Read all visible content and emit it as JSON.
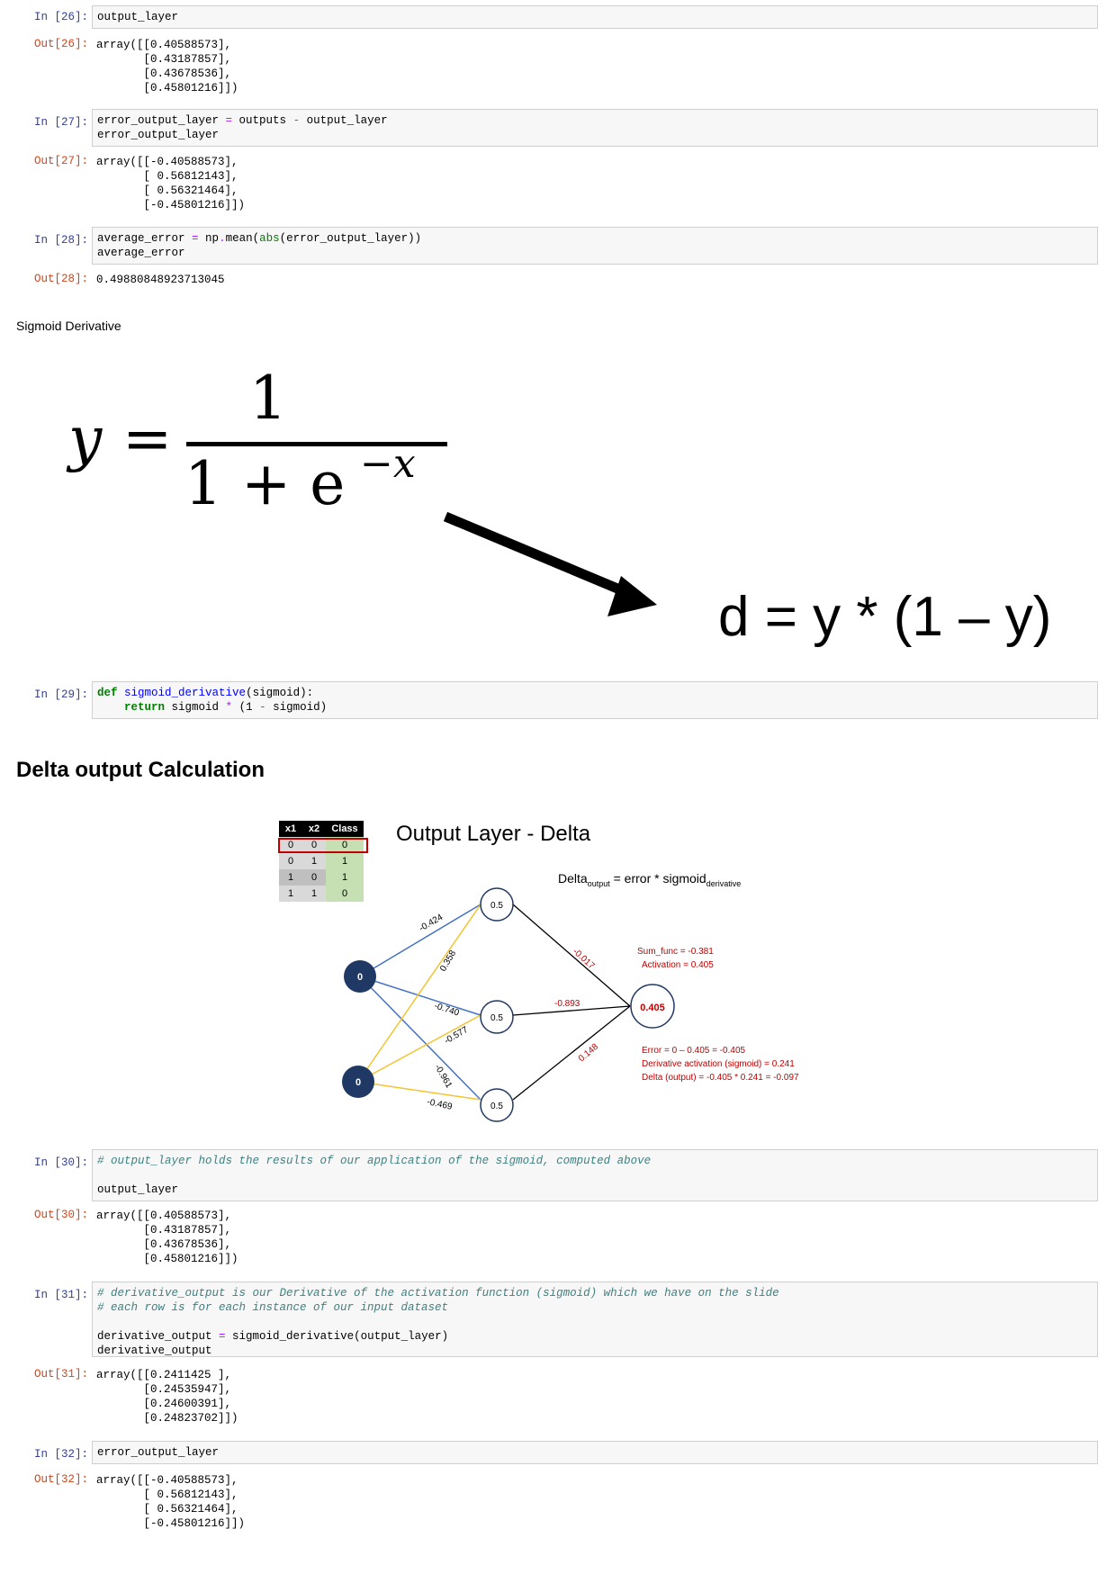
{
  "cells": [
    {
      "id": "26",
      "prompt_in": "In [26]:",
      "input": "output_layer",
      "prompt_out": "Out[26]:",
      "output": "array([[0.40588573],\n       [0.43187857],\n       [0.43678536],\n       [0.45801216]])"
    },
    {
      "id": "27",
      "prompt_in": "In [27]:",
      "input": "error_output_layer = outputs - output_layer\nerror_output_layer",
      "prompt_out": "Out[27]:",
      "output": "array([[-0.40588573],\n       [ 0.56812143],\n       [ 0.56321464],\n       [-0.45801216]])"
    },
    {
      "id": "28",
      "prompt_in": "In [28]:",
      "input": "average_error = np.mean(abs(error_output_layer))\naverage_error",
      "prompt_out": "Out[28]:",
      "output": "0.49880848923713045"
    },
    {
      "id": "29",
      "prompt_in": "In [29]:",
      "input": "def sigmoid_derivative(sigmoid):\n    return sigmoid * (1 - sigmoid)"
    },
    {
      "id": "30",
      "prompt_in": "In [30]:",
      "input": "# output_layer holds the results of our application of the sigmoid, computed above\n\noutput_layer",
      "prompt_out": "Out[30]:",
      "output": "array([[0.40588573],\n       [0.43187857],\n       [0.43678536],\n       [0.45801216]])"
    },
    {
      "id": "31",
      "prompt_in": "In [31]:",
      "input": "# derivative_output is our Derivative of the activation function (sigmoid) which we have on the slide\n# each row is for each instance of our input dataset\n\nderivative_output = sigmoid_derivative(output_layer)\nderivative_output",
      "prompt_out": "Out[31]:",
      "output": "array([[0.2411425 ],\n       [0.24535947],\n       [0.24600391],\n       [0.24823702]])"
    },
    {
      "id": "32",
      "prompt_in": "In [32]:",
      "input": "error_output_layer",
      "prompt_out": "Out[32]:",
      "output": "array([[-0.40588573],\n       [ 0.56812143],\n       [ 0.56321464],\n       [-0.45801216]])"
    }
  ],
  "markdown": {
    "sigmoid_label": "Sigmoid Derivative",
    "delta_heading": "Delta output Calculation"
  },
  "formula": {
    "lhs": "y",
    "eq": "=",
    "numerator": "1",
    "denominator_base": "1 + e",
    "denominator_exp": "−x",
    "derivative": "d = y * (1 – y)"
  },
  "diagram": {
    "title": "Output Layer - Delta",
    "delta_formula_main": "Delta",
    "delta_formula_sub1": "output",
    "delta_formula_mid": " = error * sigmoid",
    "delta_formula_sub2": "derivative",
    "table": {
      "headers": [
        "x1",
        "x2",
        "Class"
      ],
      "rows": [
        [
          "0",
          "0",
          "0"
        ],
        [
          "0",
          "1",
          "1"
        ],
        [
          "1",
          "0",
          "1"
        ],
        [
          "1",
          "1",
          "0"
        ]
      ]
    },
    "input_nodes": [
      "0",
      "0"
    ],
    "hidden_nodes": [
      "0.5",
      "0.5",
      "0.5"
    ],
    "output_node": "0.405",
    "weights_in": [
      "-0.424",
      "0.358",
      "-0.740",
      "-0.577",
      "-0.961",
      "-0.469"
    ],
    "weights_out": [
      "-0.017",
      "-0.893",
      "0.148"
    ],
    "annot_sum": "Sum_func = -0.381",
    "annot_act": "Activation = 0.405",
    "annot_err": "Error = 0 – 0.405 = -0.405",
    "annot_deriv": "Derivative activation (sigmoid) = 0.241",
    "annot_delta": "Delta (output) = -0.405 * 0.241 = -0.097",
    "colors": {
      "input_node": "#1f3864",
      "blue_edge": "#4472c4",
      "yellow_edge": "#f4c430",
      "red": "#c00000"
    }
  }
}
